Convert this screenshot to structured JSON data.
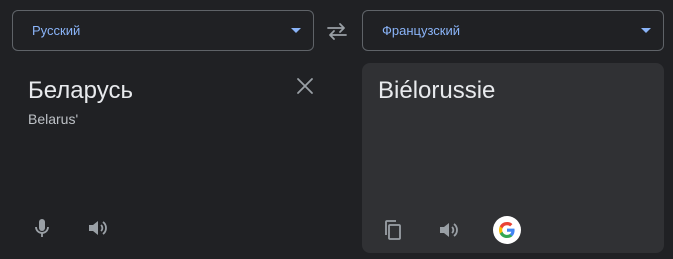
{
  "source_language": {
    "label": "Русский",
    "dropdown_icon": "caret-down-icon"
  },
  "target_language": {
    "label": "Французский",
    "dropdown_icon": "caret-down-icon"
  },
  "swap": {
    "icon": "swap-arrows-icon"
  },
  "source": {
    "text": "Беларусь",
    "transliteration": "Belarus'",
    "clear_icon": "close-icon",
    "mic_icon": "microphone-icon",
    "speaker_icon": "speaker-icon"
  },
  "target": {
    "text": "Biélorussie",
    "copy_icon": "copy-icon",
    "speaker_icon": "speaker-icon",
    "google_icon": "google-g-icon"
  },
  "colors": {
    "background": "#202124",
    "panel": "#303134",
    "accent": "#8ab4f8",
    "text": "#e8eaed",
    "muted_text": "#bdc1c6",
    "icon": "#9aa0a6"
  }
}
